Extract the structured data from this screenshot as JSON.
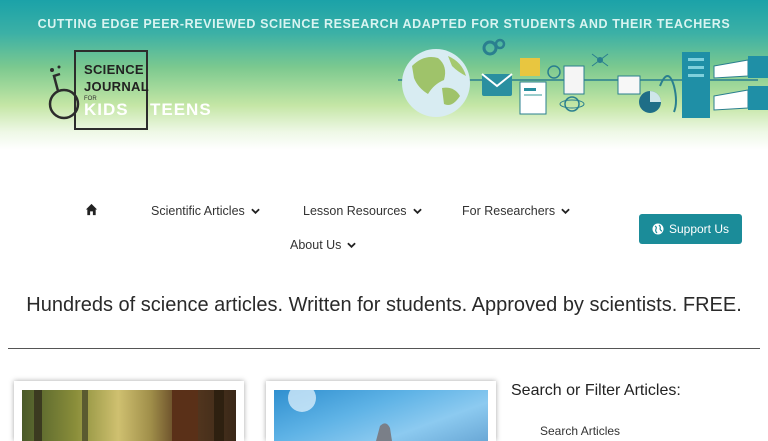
{
  "header": {
    "tagline": "CUTTING EDGE PEER-REVIEWED SCIENCE RESEARCH ADAPTED FOR STUDENTS AND THEIR TEACHERS",
    "logo": {
      "line1": "SCIENCE",
      "line2": "JOURNAL",
      "for": "FOR",
      "kids": "KIDS",
      "teens": "TEENS"
    }
  },
  "nav": {
    "home_icon": "home-icon",
    "items": [
      {
        "label": "Scientific Articles",
        "icon": "chevron-down-icon"
      },
      {
        "label": "Lesson Resources",
        "icon": "chevron-down-icon"
      },
      {
        "label": "For Researchers",
        "icon": "chevron-down-icon"
      },
      {
        "label": "About Us",
        "icon": "chevron-down-icon"
      }
    ],
    "support": {
      "label": "Support Us",
      "icon": "globe-icon"
    }
  },
  "main": {
    "headline": "Hundreds of science articles. Written for students. Approved by scientists. FREE."
  },
  "sidebar": {
    "filter_title": "Search or Filter Articles:",
    "search_label": "Search Articles"
  },
  "colors": {
    "accent": "#1b8c99",
    "banner_top": "#1ba2a8",
    "banner_mid": "#7cc98f"
  }
}
